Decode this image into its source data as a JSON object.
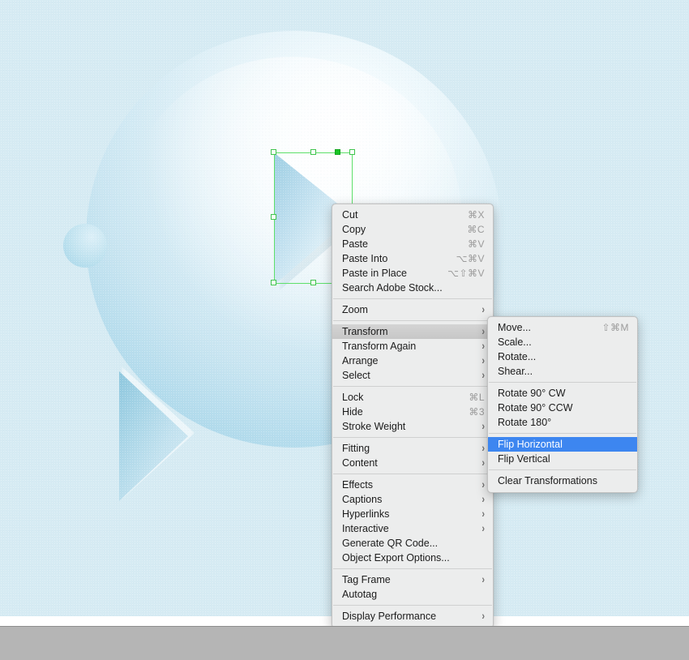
{
  "app": {
    "canvas_background": "#d6ebf3",
    "selection_color": "#5ee06a",
    "highlight_blue": "#3d86f0",
    "highlight_gray": "#cccccc"
  },
  "artwork": {
    "lens_label": "magnifying-glass-lens",
    "selected_shape_label": "triangle-play-shape",
    "second_shape_label": "triangle-play-shape-small"
  },
  "context_menu": {
    "name": "object-context-menu",
    "groups": [
      {
        "items": [
          {
            "label": "Cut",
            "shortcut": "⌘X",
            "submenu": false
          },
          {
            "label": "Copy",
            "shortcut": "⌘C",
            "submenu": false
          },
          {
            "label": "Paste",
            "shortcut": "⌘V",
            "submenu": false
          },
          {
            "label": "Paste Into",
            "shortcut": "⌥⌘V",
            "submenu": false
          },
          {
            "label": "Paste in Place",
            "shortcut": "⌥⇧⌘V",
            "submenu": false
          },
          {
            "label": "Search Adobe Stock...",
            "shortcut": "",
            "submenu": false
          }
        ]
      },
      {
        "items": [
          {
            "label": "Zoom",
            "shortcut": "",
            "submenu": true
          }
        ]
      },
      {
        "items": [
          {
            "label": "Transform",
            "shortcut": "",
            "submenu": true,
            "state": "open"
          },
          {
            "label": "Transform Again",
            "shortcut": "",
            "submenu": true
          },
          {
            "label": "Arrange",
            "shortcut": "",
            "submenu": true
          },
          {
            "label": "Select",
            "shortcut": "",
            "submenu": true
          }
        ]
      },
      {
        "items": [
          {
            "label": "Lock",
            "shortcut": "⌘L",
            "submenu": false
          },
          {
            "label": "Hide",
            "shortcut": "⌘3",
            "submenu": false
          },
          {
            "label": "Stroke Weight",
            "shortcut": "",
            "submenu": true
          }
        ]
      },
      {
        "items": [
          {
            "label": "Fitting",
            "shortcut": "",
            "submenu": true
          },
          {
            "label": "Content",
            "shortcut": "",
            "submenu": true
          }
        ]
      },
      {
        "items": [
          {
            "label": "Effects",
            "shortcut": "",
            "submenu": true
          },
          {
            "label": "Captions",
            "shortcut": "",
            "submenu": true
          },
          {
            "label": "Hyperlinks",
            "shortcut": "",
            "submenu": true
          },
          {
            "label": "Interactive",
            "shortcut": "",
            "submenu": true
          },
          {
            "label": "Generate QR Code...",
            "shortcut": "",
            "submenu": false
          },
          {
            "label": "Object Export Options...",
            "shortcut": "",
            "submenu": false
          }
        ]
      },
      {
        "items": [
          {
            "label": "Tag Frame",
            "shortcut": "",
            "submenu": true
          },
          {
            "label": "Autotag",
            "shortcut": "",
            "submenu": false
          }
        ]
      },
      {
        "items": [
          {
            "label": "Display Performance",
            "shortcut": "",
            "submenu": true
          }
        ]
      }
    ]
  },
  "transform_submenu": {
    "name": "transform-submenu",
    "groups": [
      {
        "items": [
          {
            "label": "Move...",
            "shortcut": "⇧⌘M",
            "submenu": false
          },
          {
            "label": "Scale...",
            "shortcut": "",
            "submenu": false
          },
          {
            "label": "Rotate...",
            "shortcut": "",
            "submenu": false
          },
          {
            "label": "Shear...",
            "shortcut": "",
            "submenu": false
          }
        ]
      },
      {
        "items": [
          {
            "label": "Rotate 90° CW",
            "shortcut": "",
            "submenu": false
          },
          {
            "label": "Rotate 90° CCW",
            "shortcut": "",
            "submenu": false
          },
          {
            "label": "Rotate 180°",
            "shortcut": "",
            "submenu": false
          }
        ]
      },
      {
        "items": [
          {
            "label": "Flip Horizontal",
            "shortcut": "",
            "submenu": false,
            "state": "selected"
          },
          {
            "label": "Flip Vertical",
            "shortcut": "",
            "submenu": false
          }
        ]
      },
      {
        "items": [
          {
            "label": "Clear Transformations",
            "shortcut": "",
            "submenu": false
          }
        ]
      }
    ]
  },
  "icons": {
    "chevron_right": "›"
  }
}
